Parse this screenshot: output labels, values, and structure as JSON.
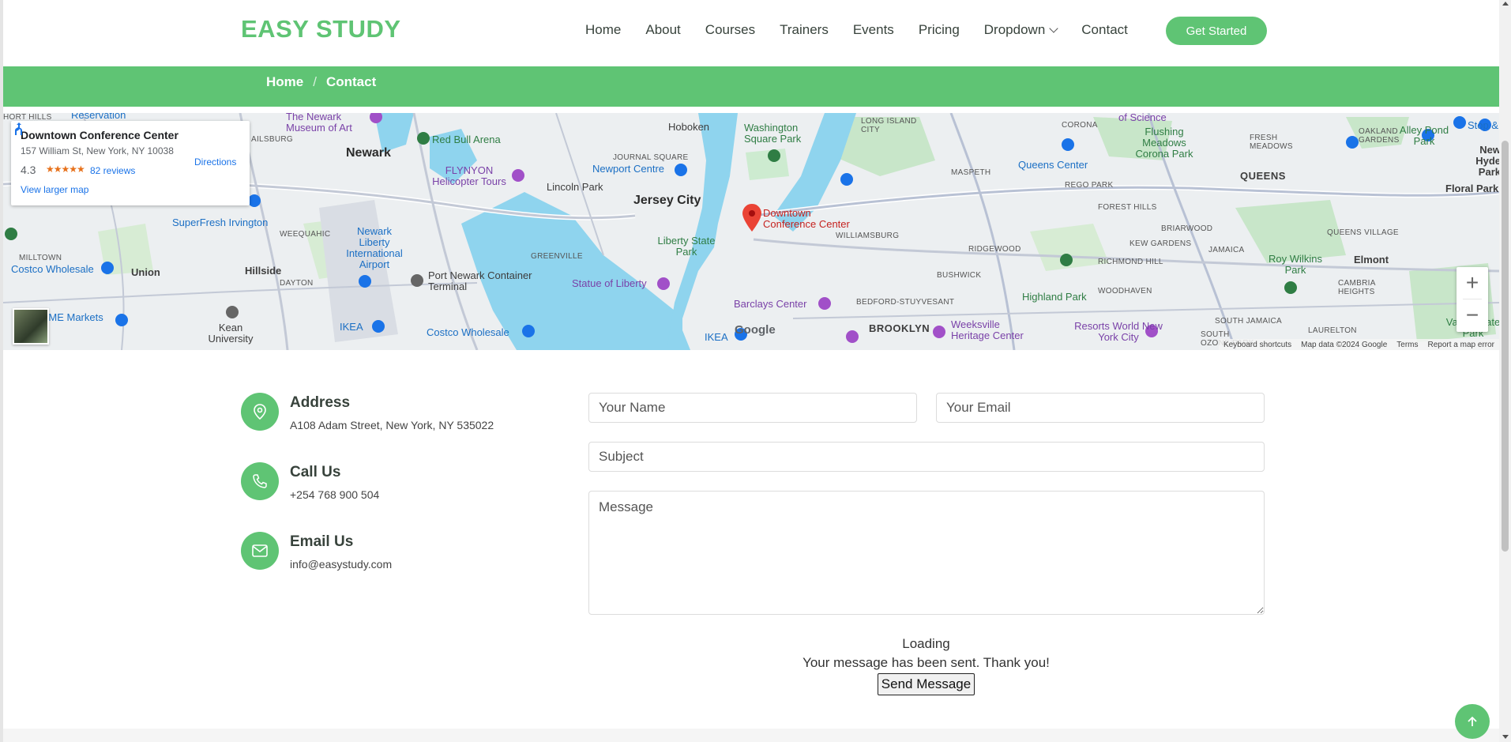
{
  "header": {
    "logo": "EASY STUDY",
    "nav": [
      {
        "label": "Home"
      },
      {
        "label": "About"
      },
      {
        "label": "Courses"
      },
      {
        "label": "Trainers"
      },
      {
        "label": "Events"
      },
      {
        "label": "Pricing"
      },
      {
        "label": "Dropdown"
      },
      {
        "label": "Contact"
      }
    ],
    "cta": "Get Started"
  },
  "breadcrumb": {
    "home": "Home",
    "separator": "/",
    "current": "Contact"
  },
  "map": {
    "place_card": {
      "title": "Downtown Conference Center",
      "address": "157 William St, New York, NY 10038",
      "rating": "4.3",
      "stars": "★★★★★",
      "reviews": "82 reviews",
      "larger_map": "View larger map",
      "directions": "Directions"
    },
    "labels": {
      "newark": "Newark",
      "jersey_city": "Jersey City",
      "queens": "QUEENS",
      "brooklyn": "BROOKLYN",
      "union": "Union",
      "hillside": "Hillside",
      "elmont": "Elmont",
      "floral_park": "Floral Park",
      "hoboken": "Hoboken",
      "marker": "Downtown Conference Center",
      "red_bull": "Red Bull Arena",
      "flynyon": "FLYNYON Helicopter Tours",
      "lincoln_park": "Lincoln Park",
      "newport": "Newport Centre",
      "washington_sq": "Washington Square Park",
      "liberty_state": "Liberty State Park",
      "statue": "Statue of Liberty",
      "port_newark": "Port Newark Container Terminal",
      "newark_airport": "Newark Liberty International Airport",
      "barclays": "Barclays Center",
      "queens_center": "Queens Center",
      "flushing": "Flushing Meadows Corona Park",
      "highland": "Highland Park",
      "weeksville": "Weeksville Heritage Center",
      "resorts": "Resorts World New York City",
      "roy_wilkins": "Roy Wilkins Park",
      "superfresh": "SuperFresh Irvington",
      "costco1": "Costco Wholesale",
      "costco2": "Costco Wholesale",
      "ikea1": "IKEA",
      "ikea2": "IKEA",
      "cme": "CME Markets",
      "kean": "Kean University",
      "williamsburg": "WILLIAMSBURG",
      "ridgewood": "RIDGEWOOD",
      "maspeth": "MASPETH",
      "bushwick": "BUSHWICK",
      "bedstuy": "BEDFORD-STUYVESANT",
      "woodhaven": "WOODHAVEN",
      "jamaica": "JAMAICA",
      "new_hyde": "New Hyde Park",
      "corona": "CORONA",
      "rego_park": "REGO PARK",
      "forest_hills": "FOREST HILLS",
      "richmond_hill": "RICHMOND HILL",
      "briarwood": "BRIARWOOD",
      "kew_gardens": "KEW GARDENS",
      "greenville": "GREENVILLE",
      "journal_sq": "JOURNAL SQUARE",
      "long_island": "LONG ISLAND CITY",
      "weequahic": "WEEQUAHIC",
      "millburn": "MILLTOWN",
      "dayton": "DAYTON",
      "oakland": "OAKLAND GARDENS",
      "alley_pond": "Alley Pond Park",
      "fresh_meadows": "FRESH MEADOWS",
      "queens_village": "QUEENS VILLAGE",
      "cambria": "CAMBRIA HEIGHTS",
      "laurelton": "LAURELTON",
      "south_jamaica": "SOUTH JAMAICA",
      "south_ozone": "SOUTH OZONE PARK",
      "valley": "Valley State Park",
      "newark_museum": "The Newark Museum of Art",
      "reservation": "Reservation",
      "short_hills": "HORT HILLS",
      "ailsburg": "AILSBURG",
      "stop": "Stop &",
      "science": "of Science"
    },
    "google": "Google",
    "footer": {
      "shortcuts": "Keyboard shortcuts",
      "data": "Map data ©2024 Google",
      "terms": "Terms",
      "report": "Report a map error"
    }
  },
  "contact": {
    "address": {
      "title": "Address",
      "text": "A108 Adam Street, New York, NY 535022"
    },
    "phone": {
      "title": "Call Us",
      "text": "+254 768 900 504"
    },
    "email": {
      "title": "Email Us",
      "text": "info@easystudy.com"
    }
  },
  "form": {
    "name_placeholder": "Your Name",
    "email_placeholder": "Your Email",
    "subject_placeholder": "Subject",
    "message_placeholder": "Message",
    "loading": "Loading",
    "sent": "Your message has been sent. Thank you!",
    "submit": "Send Message"
  },
  "colors": {
    "accent": "#5fc474",
    "text": "#37423b"
  }
}
